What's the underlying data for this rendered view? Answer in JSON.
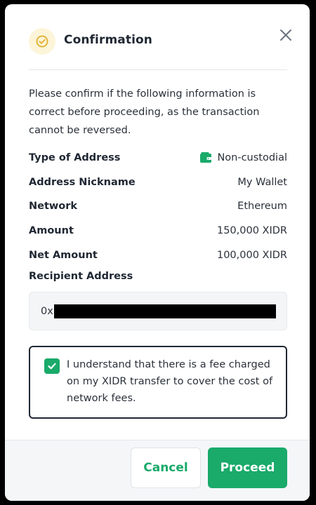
{
  "dialog": {
    "title": "Confirmation",
    "intro": "Please confirm if the following information is correct before proceeding, as the transaction cannot be reversed."
  },
  "details": [
    {
      "label": "Type of Address",
      "value": "Non-custodial",
      "icon": "wallet-icon"
    },
    {
      "label": "Address Nickname",
      "value": "My Wallet"
    },
    {
      "label": "Network",
      "value": "Ethereum"
    },
    {
      "label": "Amount",
      "value": "150,000 XIDR"
    },
    {
      "label": "Net Amount",
      "value": "100,000 XIDR"
    }
  ],
  "recipient": {
    "label": "Recipient Address",
    "prefix": "0x"
  },
  "acknowledgement": {
    "checked": true,
    "text": "I understand that there is a fee charged on my XIDR transfer to cover the cost of network fees."
  },
  "footer": {
    "cancel_label": "Cancel",
    "proceed_label": "Proceed"
  },
  "colors": {
    "accent": "#1aaa6a",
    "icon_bg": "#fdf5d9",
    "icon_fg": "#e2b53a",
    "text_dark": "#1f2733"
  }
}
